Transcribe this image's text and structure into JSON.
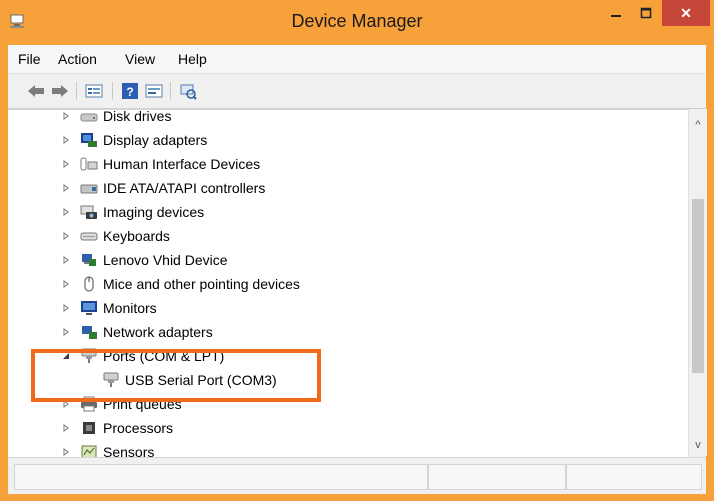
{
  "window": {
    "title": "Device Manager"
  },
  "menu": [
    "File",
    "Action",
    "View",
    "Help"
  ],
  "tree": {
    "items": [
      {
        "label": "Disk drives",
        "expanded": false,
        "icon": "disk-drive-icon"
      },
      {
        "label": "Display adapters",
        "expanded": false,
        "icon": "display-adapter-icon"
      },
      {
        "label": "Human Interface Devices",
        "expanded": false,
        "icon": "hid-icon"
      },
      {
        "label": "IDE ATA/ATAPI controllers",
        "expanded": false,
        "icon": "ide-controller-icon"
      },
      {
        "label": "Imaging devices",
        "expanded": false,
        "icon": "imaging-device-icon"
      },
      {
        "label": "Keyboards",
        "expanded": false,
        "icon": "keyboard-icon"
      },
      {
        "label": "Lenovo Vhid Device",
        "expanded": false,
        "icon": "lenovo-device-icon"
      },
      {
        "label": "Mice and other pointing devices",
        "expanded": false,
        "icon": "mouse-icon"
      },
      {
        "label": "Monitors",
        "expanded": false,
        "icon": "monitor-icon"
      },
      {
        "label": "Network adapters",
        "expanded": false,
        "icon": "network-adapter-icon"
      },
      {
        "label": "Ports (COM & LPT)",
        "expanded": true,
        "icon": "port-icon"
      },
      {
        "label": "USB Serial Port (COM3)",
        "child": true,
        "icon": "port-icon"
      },
      {
        "label": "Print queues",
        "expanded": false,
        "icon": "printer-icon"
      },
      {
        "label": "Processors",
        "expanded": false,
        "icon": "processor-icon"
      },
      {
        "label": "Sensors",
        "expanded": false,
        "icon": "sensor-icon"
      }
    ]
  },
  "colors": {
    "title_bar": "#f6a13a",
    "close_button": "#c7463a",
    "highlight": "#f06a1c"
  }
}
